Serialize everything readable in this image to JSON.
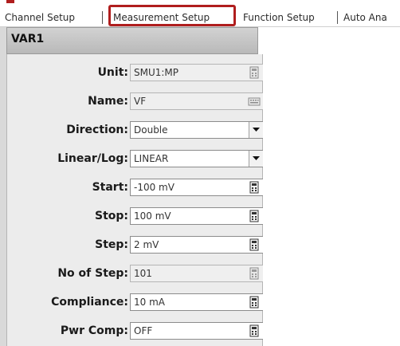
{
  "tabs": [
    {
      "label": "Channel Setup"
    },
    {
      "label": "Measurement Setup"
    },
    {
      "label": "Function Setup"
    },
    {
      "label": "Auto Ana"
    }
  ],
  "panel": {
    "title": "VAR1",
    "rows": [
      {
        "label": "Unit:",
        "value": "SMU1:MP",
        "kind": "field",
        "icon": "calculator-icon",
        "readonly": true
      },
      {
        "label": "Name:",
        "value": "VF",
        "kind": "field",
        "icon": "keyboard-icon",
        "readonly": true
      },
      {
        "label": "Direction:",
        "value": "Double",
        "kind": "select",
        "icon": "dropdown-arrow-icon",
        "readonly": false
      },
      {
        "label": "Linear/Log:",
        "value": "LINEAR",
        "kind": "select",
        "icon": "dropdown-arrow-icon",
        "readonly": false
      },
      {
        "label": "Start:",
        "value": "-100 mV",
        "kind": "field",
        "icon": "calculator-icon",
        "readonly": false
      },
      {
        "label": "Stop:",
        "value": "100 mV",
        "kind": "field",
        "icon": "calculator-icon",
        "readonly": false
      },
      {
        "label": "Step:",
        "value": "2 mV",
        "kind": "field",
        "icon": "calculator-icon",
        "readonly": false
      },
      {
        "label": "No of Step:",
        "value": "101",
        "kind": "field",
        "icon": "calculator-icon",
        "readonly": true
      },
      {
        "label": "Compliance:",
        "value": "10 mA",
        "kind": "field",
        "icon": "calculator-icon",
        "readonly": false
      },
      {
        "label": "Pwr Comp:",
        "value": "OFF",
        "kind": "field",
        "icon": "calculator-icon",
        "readonly": false
      }
    ]
  },
  "colors": {
    "highlight": "#b01e1e",
    "header_bg": "#c4c4c4",
    "panel_bg": "#ececec"
  }
}
